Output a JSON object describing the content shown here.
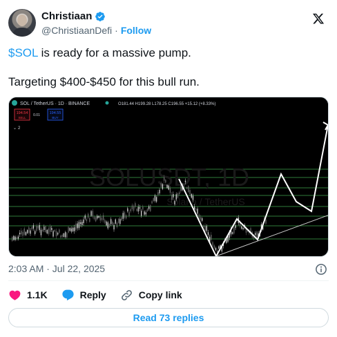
{
  "author": {
    "name": "Christiaan",
    "handle": "@ChristiaanDefi",
    "separator": "·",
    "follow_label": "Follow",
    "verified": true
  },
  "tweet": {
    "cashtag": "$SOL",
    "line1_rest": " is ready for a massive pump.",
    "line2": "Targeting $400-$450 for this bull run."
  },
  "media": {
    "symbol": "SOL / TetherUS · 1D · BINANCE",
    "ohlc": "O181.44 H199.28 L178.25 C196.55 +15.12 (+8.33%)",
    "sell_price": "194.54",
    "sell_label": "SELL",
    "spread": "0.01",
    "buy_price": "194.55",
    "buy_label": "BUY",
    "indicator_count": "2",
    "watermark_title": "SOLUSDT, 1D",
    "watermark_sub": "Solana / TetherUS"
  },
  "meta": {
    "timestamp": "2:03 AM · Jul 22, 2025"
  },
  "actions": {
    "likes": "1.1K",
    "reply_label": "Reply",
    "copy_link_label": "Copy link"
  },
  "replies_button": "Read 73 replies",
  "colors": {
    "accent": "#1d9bf0",
    "like": "#f91880",
    "text": "#0f1419",
    "muted": "#536471"
  }
}
